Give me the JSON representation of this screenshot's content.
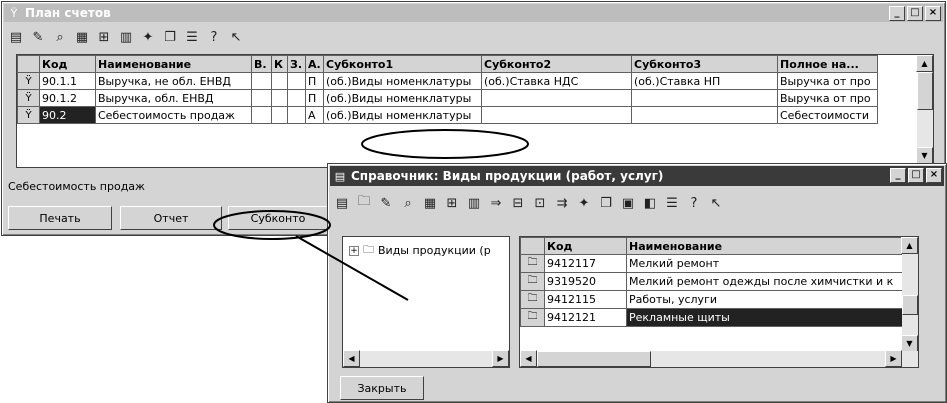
{
  "main_window": {
    "title": "План счетов",
    "controls": [
      "_",
      "□",
      "×"
    ],
    "columns": [
      "",
      "Код",
      "Наименование",
      "В.",
      "К",
      "З.",
      "А.",
      "Субконто1",
      "Субконто2",
      "Субконто3",
      "Полное на..."
    ],
    "rows": [
      {
        "mark": "Ϋ",
        "code": "90.1.1",
        "name": "Выручка, не обл. ЕНВД",
        "v": "",
        "k": "",
        "z": "",
        "a": "П",
        "sub1": "(об.)Виды номенклатуры",
        "sub2": "(об.)Ставка НДС",
        "sub3": "(об.)Ставка НП",
        "full": "Выручка от про"
      },
      {
        "mark": "Ϋ",
        "code": "90.1.2",
        "name": "Выручка, обл. ЕНВД",
        "v": "",
        "k": "",
        "z": "",
        "a": "П",
        "sub1": "(об.)Виды номенклатуры",
        "sub2": "",
        "sub3": "",
        "full": "Выручка от про"
      },
      {
        "mark": "Ϋ",
        "code": "90.2",
        "name": "Себестоимость продаж",
        "v": "",
        "k": "",
        "z": "",
        "a": "А",
        "sub1": "(об.)Виды номенклатуры",
        "sub2": "",
        "sub3": "",
        "full": "Себестоимости"
      }
    ],
    "status_text": "Себестоимость продаж",
    "buttons": {
      "print": "Печать",
      "report": "Отчет",
      "subconto": "Субконто"
    }
  },
  "dialog": {
    "title": "Справочник: Виды продукции (работ, услуг)",
    "tree_root": "Виды продукции (р",
    "columns": [
      "",
      "Код",
      "Наименование"
    ],
    "rows": [
      {
        "code": "9412117",
        "name": "Мелкий ремонт"
      },
      {
        "code": "9319520",
        "name": "Мелкий ремонт одежды после химчистки и к"
      },
      {
        "code": "9412115",
        "name": "Работы, услуги"
      },
      {
        "code": "9412121",
        "name": "Рекламные щиты"
      }
    ],
    "close_button": "Закрыть"
  }
}
